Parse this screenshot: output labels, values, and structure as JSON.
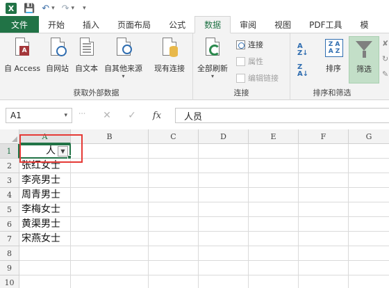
{
  "app": {
    "logo_letter": "X"
  },
  "tabs": [
    "文件",
    "开始",
    "插入",
    "页面布局",
    "公式",
    "数据",
    "审阅",
    "视图",
    "PDF工具",
    "模"
  ],
  "active_tab": "数据",
  "ribbon": {
    "get_external": {
      "label": "获取外部数据",
      "buttons": [
        "自 Access",
        "自网站",
        "自文本",
        "自其他来源",
        "现有连接"
      ]
    },
    "connections": {
      "label": "连接",
      "refresh_all": "全部刷新",
      "connect": "连接",
      "properties": "属性",
      "edit_links": "编辑链接"
    },
    "sort_filter": {
      "label": "排序和筛选",
      "sort": "排序",
      "filter": "筛选"
    }
  },
  "formula_bar": {
    "name_box": "A1",
    "fx_label": "fx",
    "value": "人员"
  },
  "columns": [
    "A",
    "B",
    "C",
    "D",
    "E",
    "F",
    "G"
  ],
  "rows": [
    "1",
    "2",
    "3",
    "4",
    "5",
    "6",
    "7",
    "8",
    "9",
    "10"
  ],
  "cells": {
    "A1": "人",
    "A2": "张红女士",
    "A3": "李亮男士",
    "A4": "周青男士",
    "A5": "李梅女士",
    "A6": "黄渠男士",
    "A7": "宋燕女士"
  },
  "colors": {
    "excel_green": "#217346",
    "highlight_red": "#e53935",
    "filter_active": "#c3dfc8"
  }
}
